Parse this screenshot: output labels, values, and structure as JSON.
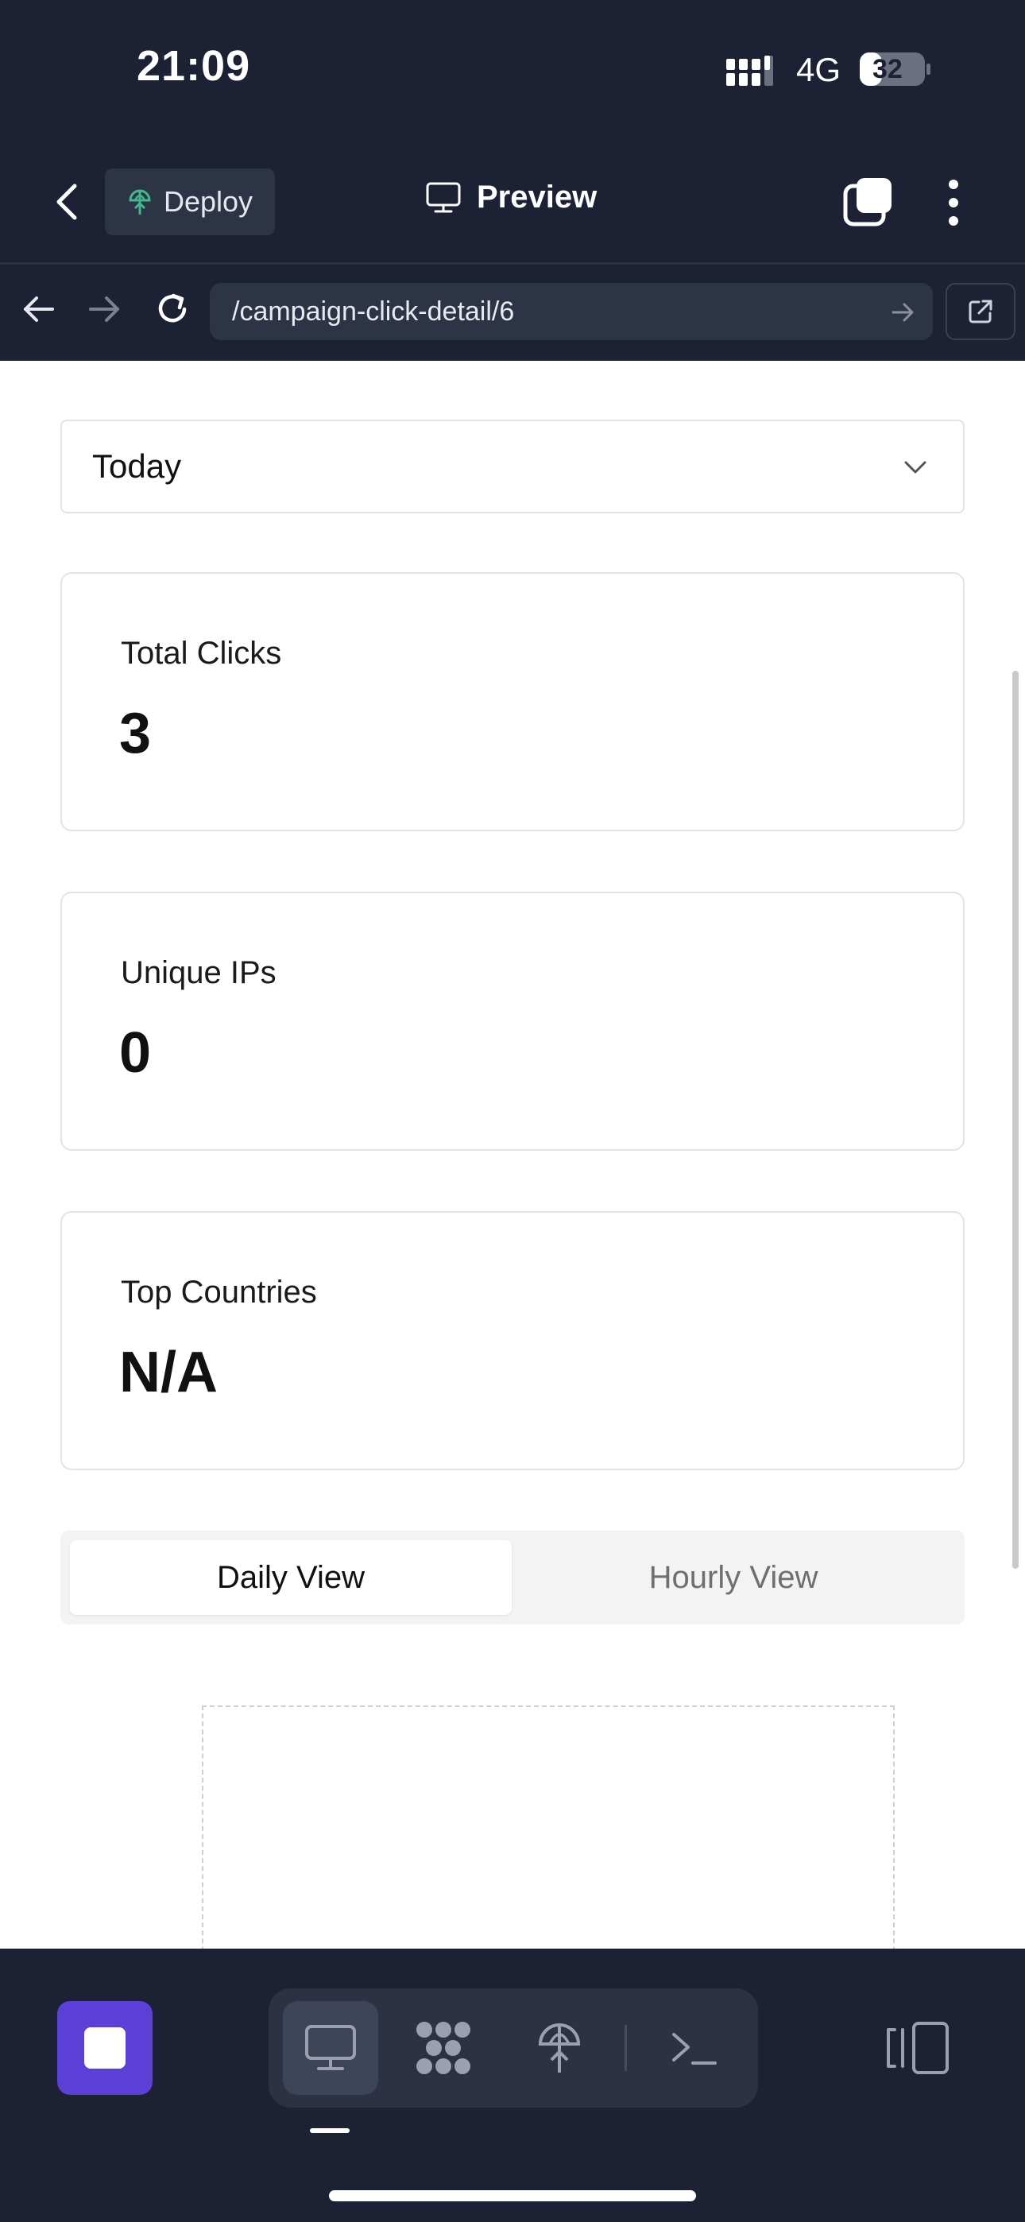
{
  "status_bar": {
    "time": "21:09",
    "network": "4G",
    "battery": "32"
  },
  "header": {
    "deploy_label": "Deploy",
    "preview_label": "Preview"
  },
  "url_bar": {
    "url": "/campaign-click-detail/6"
  },
  "page": {
    "date_select": "Today",
    "stats": [
      {
        "label": "Total Clicks",
        "value": "3"
      },
      {
        "label": "Unique IPs",
        "value": "0"
      },
      {
        "label": "Top Countries",
        "value": "N/A"
      }
    ],
    "view_tabs": {
      "daily": "Daily View",
      "hourly": "Hourly View",
      "selected": "daily"
    }
  },
  "colors": {
    "app_bg": "#1c2133",
    "accent": "#5b3fd6",
    "deploy_icon": "#3fb98a"
  },
  "icons": [
    "chevron-left-icon",
    "globe-icon",
    "monitor-icon",
    "tabs-icon",
    "more-vertical-icon",
    "arrow-left-icon",
    "arrow-right-icon",
    "reload-icon",
    "external-link-icon",
    "chevron-down-icon",
    "stop-icon",
    "apps-icon",
    "terminal-icon",
    "panel-icon"
  ]
}
